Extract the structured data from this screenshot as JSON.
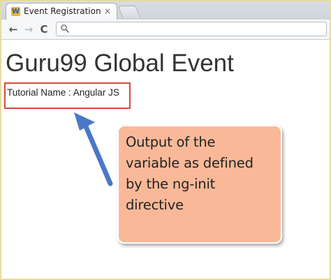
{
  "browser": {
    "tab": {
      "favicon_label": "W",
      "title": "Event Registration",
      "close_label": "×"
    },
    "toolbar": {
      "back_label": "←",
      "forward_label": "→",
      "reload_label": "C",
      "address_value": "",
      "address_placeholder": ""
    }
  },
  "page": {
    "heading": "Guru99 Global Event",
    "tutorial_line": "Tutorial Name : Angular JS"
  },
  "annotation": {
    "callout_text": "Output of the\nvariable as defined\nby the ng-init\ndirective",
    "arrow_color": "#4a78c8",
    "callout_color": "#f9b998",
    "highlight_color": "#d94a3d"
  }
}
